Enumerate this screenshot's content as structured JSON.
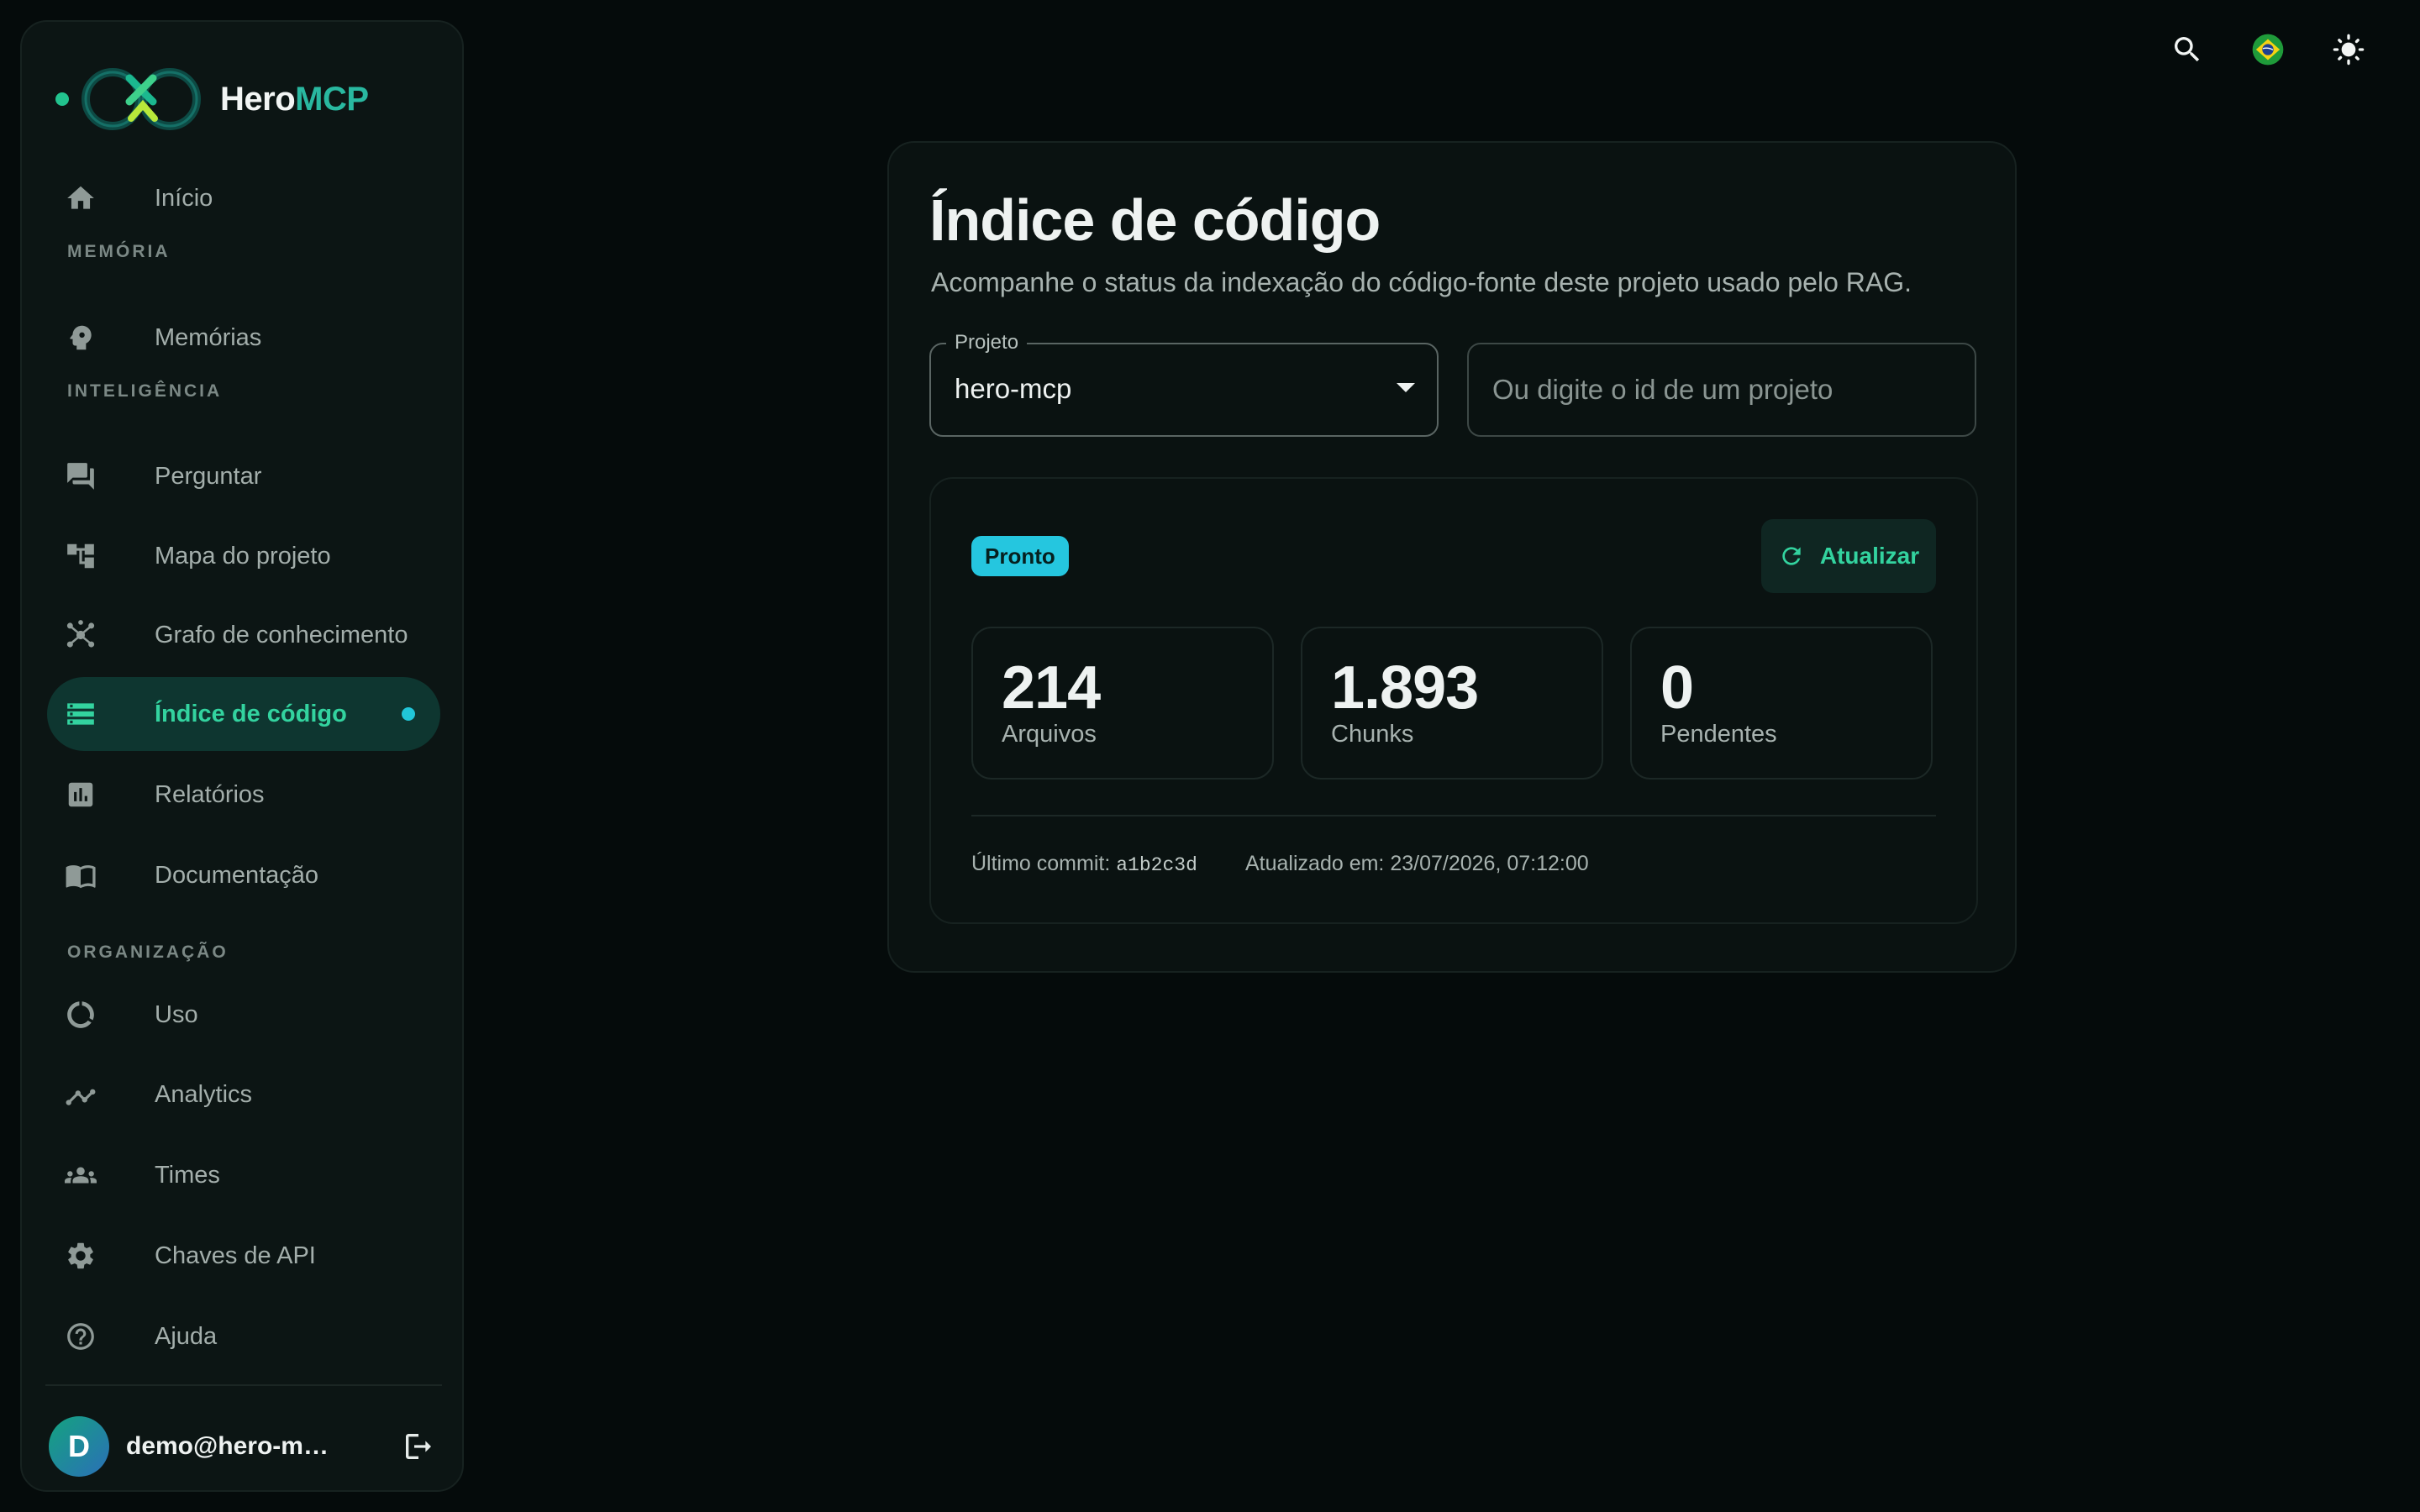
{
  "brand": {
    "name_main": "Hero",
    "name_accent": "MCP",
    "accent_color": "#29b8a0",
    "status_color": "#22c38e"
  },
  "sidebar": {
    "sections": {
      "memoria": "MEMÓRIA",
      "inteligencia": "INTELIGÊNCIA",
      "organizacao": "ORGANIZAÇÃO"
    },
    "items": [
      {
        "label": "Início",
        "icon": "home-icon"
      },
      {
        "label": "Memórias",
        "icon": "brain-head-icon"
      },
      {
        "label": "Perguntar",
        "icon": "chat-icon"
      },
      {
        "label": "Mapa do projeto",
        "icon": "tree-map-icon"
      },
      {
        "label": "Grafo de conhecimento",
        "icon": "graph-icon"
      },
      {
        "label": "Índice de código",
        "icon": "storage-icon",
        "active": true
      },
      {
        "label": "Relatórios",
        "icon": "bar-chart-icon"
      },
      {
        "label": "Documentação",
        "icon": "book-icon"
      },
      {
        "label": "Uso",
        "icon": "donut-icon"
      },
      {
        "label": "Analytics",
        "icon": "trend-icon"
      },
      {
        "label": "Times",
        "icon": "group-icon"
      },
      {
        "label": "Chaves de API",
        "icon": "gear-icon"
      },
      {
        "label": "Ajuda",
        "icon": "help-icon"
      }
    ],
    "user": {
      "initial": "D",
      "email": "demo@hero-mcp.dev"
    }
  },
  "page": {
    "title": "Índice de código",
    "subtitle": "Acompanhe o status da indexação do código-fonte deste projeto usado pelo RAG.",
    "project_select": {
      "label": "Projeto",
      "value": "hero-mcp"
    },
    "project_input": {
      "placeholder": "Ou digite o id de um projeto",
      "value": ""
    }
  },
  "status": {
    "badge": "Pronto",
    "refresh_label": "Atualizar",
    "stats": [
      {
        "value": "214",
        "label": "Arquivos"
      },
      {
        "value": "1.893",
        "label": "Chunks"
      },
      {
        "value": "0",
        "label": "Pendentes"
      }
    ],
    "last_commit_label": "Último commit:",
    "last_commit": "a1b2c3d",
    "updated_label": "Atualizado em:",
    "updated_at": "23/07/2026, 07:12:00"
  },
  "colors": {
    "active": "#33d39f",
    "badge": "#25c6df",
    "background": "#050b0b"
  }
}
